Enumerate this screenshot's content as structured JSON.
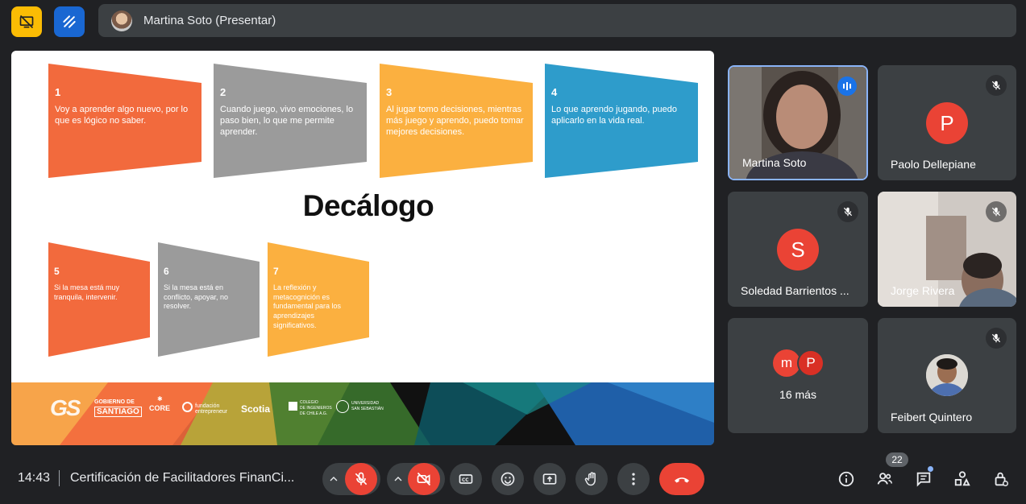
{
  "presenter": {
    "name": "Martina Soto (Presentar)"
  },
  "slide": {
    "title": "Decálogo",
    "cards": [
      {
        "num": "1",
        "text": "Voy a aprender algo nuevo, por lo que es lógico no saber.",
        "color": "#f26a3d"
      },
      {
        "num": "2",
        "text": "Cuando juego, vivo emociones, lo paso bien, lo que me permite aprender.",
        "color": "#9b9b9b"
      },
      {
        "num": "3",
        "text": "Al jugar tomo decisiones, mientras más juego y aprendo, puedo tomar mejores decisiones.",
        "color": "#fbb040"
      },
      {
        "num": "4",
        "text": "Lo que aprendo jugando, puedo aplicarlo en la vida real.",
        "color": "#2e9ccb"
      },
      {
        "num": "5",
        "text": "Si la mesa está muy tranquila, intervenir.",
        "color": "#f26a3d"
      },
      {
        "num": "6",
        "text": "Si la mesa está en conflicto, apoyar, no resolver.",
        "color": "#9b9b9b"
      },
      {
        "num": "7",
        "text": "La reflexión y metacognición es fundamental para los aprendizajes significativos.",
        "color": "#fbb040"
      }
    ],
    "footer_logos": {
      "gs": "GS",
      "gobierno": "GOBIERNO DE",
      "santiago": "SANTIAGO",
      "core": "CORE",
      "fundacion": "fundación",
      "entrepreneur": "entrepreneur",
      "scotia": "Scotia",
      "colegio1": "COLEGIO",
      "colegio2": "DE INGENIEROS",
      "colegio3": "DE CHILE A.G.",
      "uss1": "UNIVERSIDAD",
      "uss2": "SAN SEBASTIÁN"
    }
  },
  "participants": [
    {
      "name": "Martina Soto",
      "type": "video",
      "speaking": true
    },
    {
      "name": "Paolo Dellepiane",
      "initial": "P",
      "color": "#ea4335",
      "muted": true
    },
    {
      "name": "Soledad Barrientos ...",
      "initial": "S",
      "color": "#ea4335",
      "muted": true
    },
    {
      "name": "Jorge Rivera",
      "type": "video",
      "muted": true
    },
    {
      "name": "16 más",
      "initials": [
        "m",
        "P"
      ]
    },
    {
      "name": "Feibert Quintero",
      "type": "photo",
      "muted": true
    }
  ],
  "bottom": {
    "time": "14:43",
    "meeting_title": "Certificación de Facilitadores FinanCi...",
    "people_count": "22"
  },
  "colors": {
    "accent_red": "#ea4335",
    "tile_bg": "#3c4043",
    "bg": "#202124",
    "active_border": "#8ab4f8"
  },
  "icons": [
    "presentation-off-icon",
    "annotate-icon",
    "chevron-up-icon",
    "mic-off-icon",
    "camera-off-icon",
    "captions-icon",
    "emoji-icon",
    "present-icon",
    "raise-hand-icon",
    "more-icon",
    "end-call-icon",
    "info-icon",
    "people-icon",
    "chat-icon",
    "activities-icon",
    "host-controls-icon"
  ]
}
